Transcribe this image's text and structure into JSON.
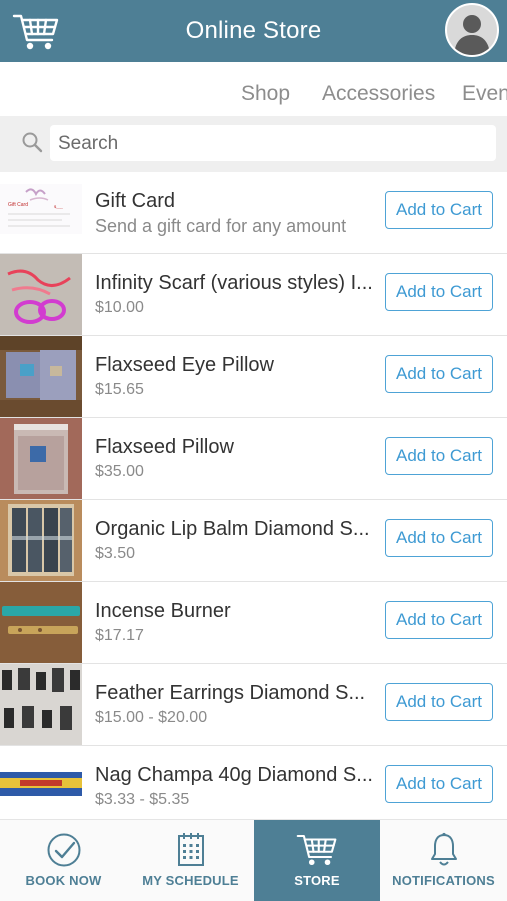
{
  "header": {
    "title": "Online Store"
  },
  "tabs": [
    "Shop",
    "Accessories",
    "Even"
  ],
  "search": {
    "placeholder": "Search",
    "value": ""
  },
  "products": [
    {
      "name": "Gift Card",
      "price": "Send a gift card for any amount",
      "button": "Add to Cart"
    },
    {
      "name": "Infinity Scarf (various styles) I...",
      "price": "$10.00",
      "button": "Add to Cart"
    },
    {
      "name": "Flaxseed Eye Pillow",
      "price": "$15.65",
      "button": "Add to Cart"
    },
    {
      "name": "Flaxseed Pillow",
      "price": "$35.00",
      "button": "Add to Cart"
    },
    {
      "name": "Organic Lip Balm Diamond S...",
      "price": "$3.50",
      "button": "Add to Cart"
    },
    {
      "name": "Incense Burner",
      "price": "$17.17",
      "button": "Add to Cart"
    },
    {
      "name": "Feather Earrings Diamond S...",
      "price": "$15.00 - $20.00",
      "button": "Add to Cart"
    },
    {
      "name": "Nag Champa 40g Diamond S...",
      "price": "$3.33 - $5.35",
      "button": "Add to Cart"
    }
  ],
  "bottom_nav": [
    {
      "label": "BOOK NOW",
      "icon": "check-circle-icon"
    },
    {
      "label": "MY SCHEDULE",
      "icon": "calendar-icon"
    },
    {
      "label": "STORE",
      "icon": "cart-icon",
      "active": true
    },
    {
      "label": "NOTIFICATIONS",
      "icon": "bell-icon"
    }
  ],
  "colors": {
    "brand": "#4e7f95",
    "accent": "#3e9ad3"
  }
}
